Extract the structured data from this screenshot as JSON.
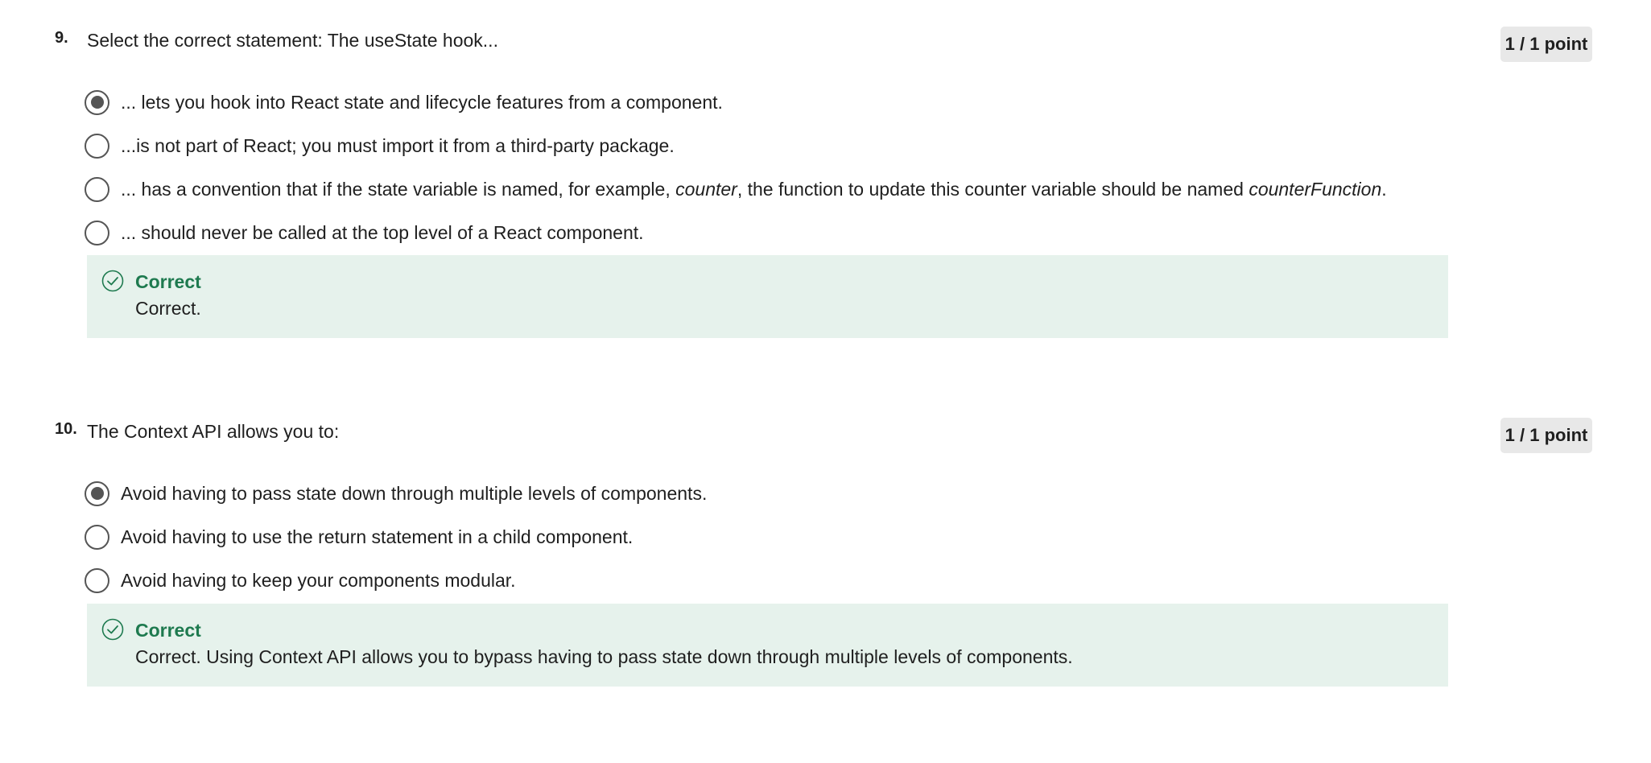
{
  "questions": [
    {
      "number": "9.",
      "prompt": "Select the correct statement: The useState hook...",
      "points": "1 / 1 point",
      "options": [
        {
          "text": "... lets you hook into React state and lifecycle features from a component.",
          "selected": true
        },
        {
          "text": "...is not  part of React; you must import it from a third-party package.",
          "selected": false
        },
        {
          "text_before": "... has a convention that if the state variable is named, for example, ",
          "text_italic_1": "counter",
          "text_middle": ", the function to update this counter variable should be named ",
          "text_italic_2": "counterFunction",
          "text_after": ".",
          "selected": false
        },
        {
          "text": "... should never be called at the top level of a React component.",
          "selected": false
        }
      ],
      "feedback": {
        "title": "Correct",
        "text": "Correct.",
        "icon": "check-circle-icon"
      }
    },
    {
      "number": "10.",
      "prompt": "The Context API allows you to:",
      "points": "1 / 1 point",
      "options": [
        {
          "text": "Avoid having to pass state down through multiple levels of components.",
          "selected": true
        },
        {
          "text": "Avoid having to use the return statement in a child component.",
          "selected": false
        },
        {
          "text": "Avoid having to keep your components modular.",
          "selected": false
        }
      ],
      "feedback": {
        "title": "Correct",
        "text": "Correct. Using Context API allows you to bypass having to pass state down through multiple levels of components.",
        "icon": "check-circle-icon"
      }
    }
  ],
  "colors": {
    "feedback_bg": "#e6f2ec",
    "correct_green": "#1e7a4f",
    "badge_bg": "#e8e8e8",
    "radio": "#555555"
  }
}
